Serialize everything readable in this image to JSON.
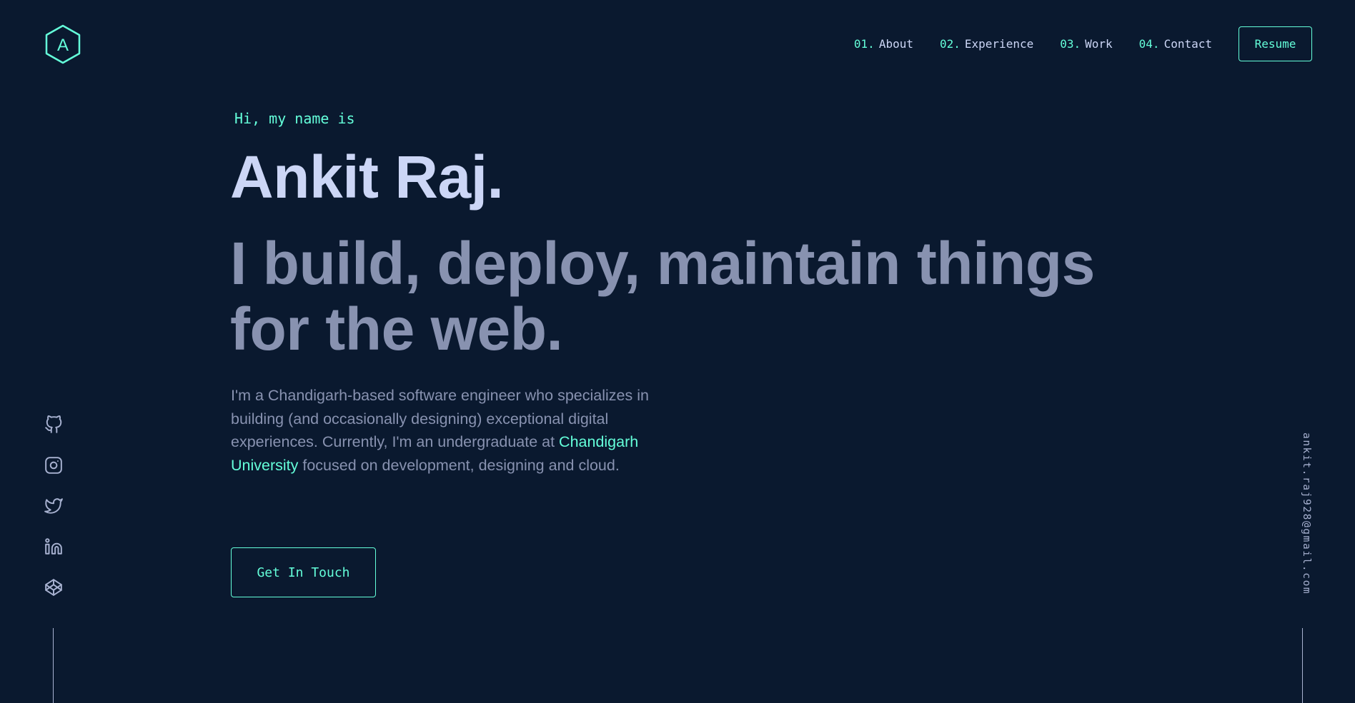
{
  "header": {
    "logo_letter": "A",
    "nav": [
      {
        "num": "01.",
        "label": "About"
      },
      {
        "num": "02.",
        "label": "Experience"
      },
      {
        "num": "03.",
        "label": "Work"
      },
      {
        "num": "04.",
        "label": "Contact"
      }
    ],
    "resume_label": "Resume"
  },
  "hero": {
    "greeting": "Hi, my name is",
    "name": "Ankit Raj.",
    "tagline": "I build, deploy, maintain things for the web.",
    "bio_part1": "I'm a Chandigarh-based software engineer who specializes in building (and occasionally designing) exceptional digital experiences. Currently, I'm an undergraduate at ",
    "bio_link": "Chandigarh University",
    "bio_part2": " focused on development, designing and cloud.",
    "cta_label": "Get In Touch"
  },
  "social": [
    "github-icon",
    "instagram-icon",
    "twitter-icon",
    "linkedin-icon",
    "codepen-icon"
  ],
  "email": "ankit.raj928@gmail.com",
  "colors": {
    "background": "#0a192f",
    "accent": "#64ffda",
    "heading": "#ccd6f6",
    "body": "#8892b0",
    "muted": "#a8b2d1"
  }
}
